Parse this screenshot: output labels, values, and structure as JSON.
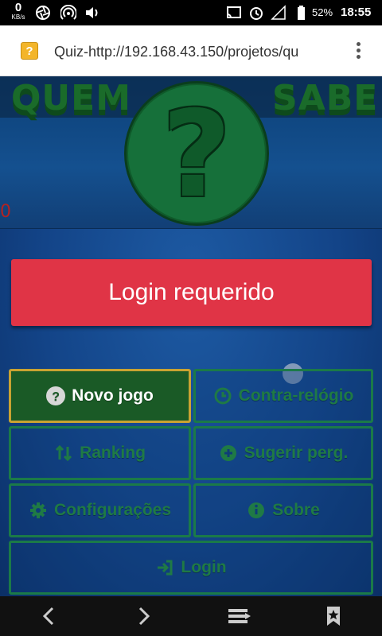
{
  "status_bar": {
    "speed_value": "0",
    "speed_unit": "KB/s",
    "battery": "52%",
    "time": "18:55"
  },
  "browser": {
    "favicon": "?",
    "url": "Quiz-http://192.168.43.150/projetos/qu",
    "menu_icon": "overflow-menu-icon"
  },
  "banner": {
    "logo_left": "QUEM",
    "logo_right": "SABE",
    "logo_mark": "?",
    "score": "0"
  },
  "login_required": "Login requerido",
  "menu": {
    "new_game": "Novo jogo",
    "time_trial": "Contra-relógio",
    "ranking": "Ranking",
    "suggest": "Sugerir perg.",
    "settings": "Configurações",
    "about": "Sobre",
    "login": "Login"
  },
  "colors": {
    "accent_red": "#e03446",
    "menu_green": "#1b7a48",
    "active_green": "#1a5a26",
    "background_blue": "#134488"
  }
}
